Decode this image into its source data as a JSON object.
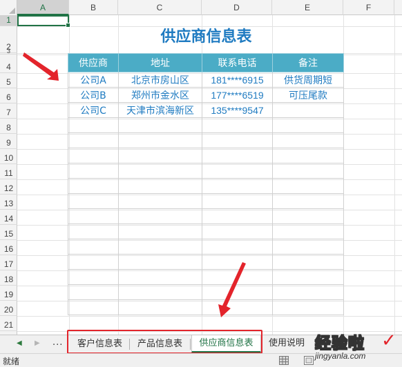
{
  "spreadsheet": {
    "columns": [
      "A",
      "B",
      "C",
      "D",
      "E",
      "F"
    ],
    "selected_column": "A",
    "row_numbers": [
      "1",
      "2",
      "3",
      "4",
      "5",
      "6",
      "7",
      "8",
      "9",
      "10",
      "11",
      "12",
      "13",
      "14",
      "15",
      "16",
      "17",
      "18",
      "19",
      "20",
      "21"
    ],
    "selected_row": "1",
    "table_title": "供应商信息表",
    "headers": [
      "供应商",
      "地址",
      "联系电话",
      "备注"
    ],
    "rows": [
      [
        "公司A",
        "北京市房山区",
        "181****6915",
        "供货周期短"
      ],
      [
        "公司B",
        "郑州市金水区",
        "177****6519",
        "可压尾款"
      ],
      [
        "公司C",
        "天津市滨海新区",
        "135****9547",
        ""
      ]
    ],
    "header_color": "#4bacc6",
    "title_color": "#1f7bc1",
    "accent_color": "#217346",
    "annotation_color": "#e3242b"
  },
  "tabs": {
    "more_label": "...",
    "items": [
      {
        "label": "客户信息表",
        "active": false
      },
      {
        "label": "产品信息表",
        "active": false
      },
      {
        "label": "供应商信息表",
        "active": true
      },
      {
        "label": "使用说明",
        "active": false
      }
    ],
    "prev_icon": "triangle-left-icon",
    "next_icon": "triangle-right-icon"
  },
  "status": {
    "ready_text": "就绪",
    "view_icons": [
      "normal-view-icon",
      "page-layout-icon",
      "page-break-icon"
    ]
  },
  "watermark": {
    "main": "经验啦",
    "check": "✓",
    "sub": "jingyanla.com"
  }
}
